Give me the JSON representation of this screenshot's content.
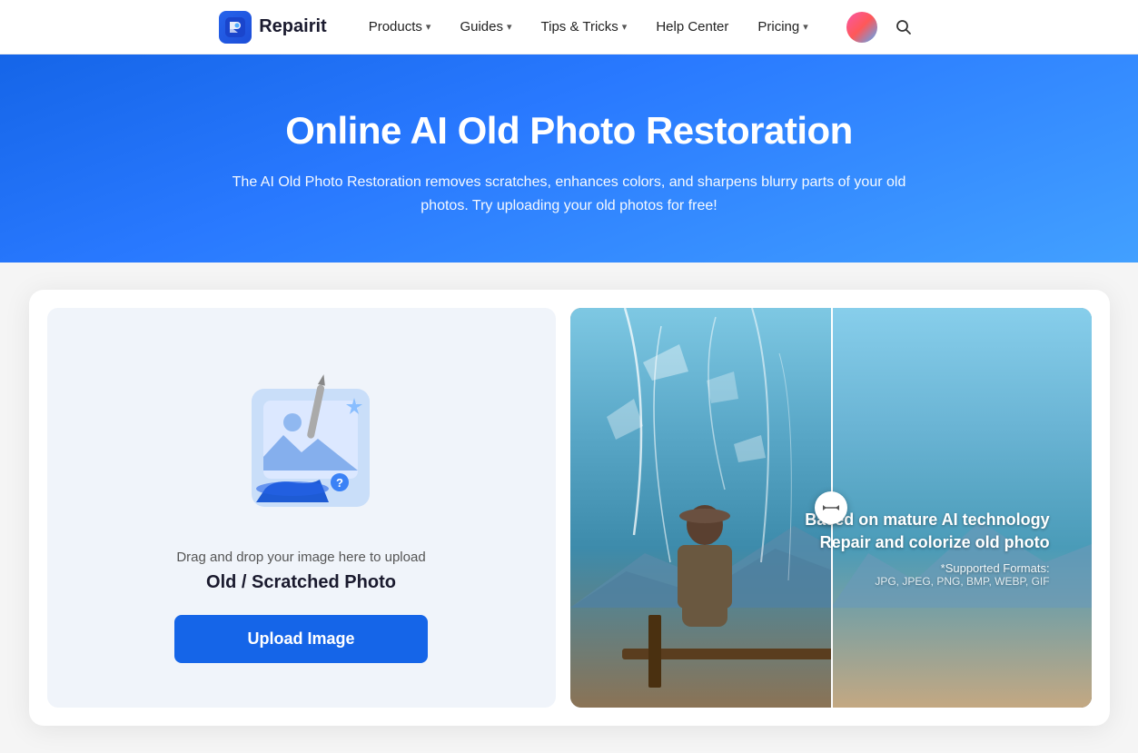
{
  "navbar": {
    "logo_text": "Repairit",
    "items": [
      {
        "label": "Products",
        "has_dropdown": true
      },
      {
        "label": "Guides",
        "has_dropdown": true
      },
      {
        "label": "Tips & Tricks",
        "has_dropdown": true
      },
      {
        "label": "Help Center",
        "has_dropdown": false
      },
      {
        "label": "Pricing",
        "has_dropdown": true
      }
    ]
  },
  "hero": {
    "title": "Online AI Old Photo Restoration",
    "subtitle": "The AI Old Photo Restoration removes scratches, enhances colors, and sharpens blurry parts of your old photos. Try uploading your old photos for free!"
  },
  "upload_panel": {
    "drag_text": "Drag and drop your image here to upload",
    "file_type_label": "Old / Scratched Photo",
    "button_label": "Upload Image"
  },
  "preview_panel": {
    "info_title": "Based on mature AI technology\nRepair and colorize old photo",
    "info_line1": "Based on mature AI technology",
    "info_line2": "Repair and colorize old photo",
    "formats_label": "*Supported Formats:",
    "formats_list": "JPG, JPEG, PNG, BMP, WEBP, GIF"
  },
  "icons": {
    "search": "🔍",
    "chevron_down": "▾",
    "logo_letter": "R"
  }
}
